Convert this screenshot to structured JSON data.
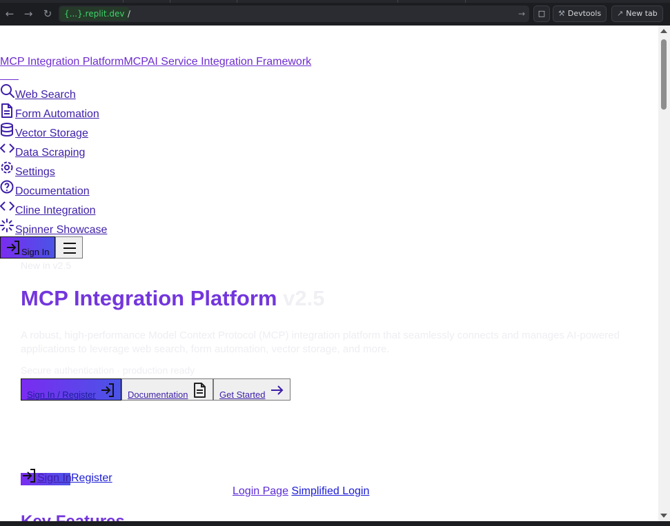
{
  "browser": {
    "url_host": "{...}.replit.dev",
    "url_path": "/",
    "devtools_label": "Devtools",
    "newtab_label": "New tab"
  },
  "header": {
    "brand_name": "MCP Integration Platform",
    "brand_short": "MCP",
    "brand_tagline": "AI Service Integration Framework"
  },
  "nav": {
    "items": [
      {
        "label": "Web Search",
        "icon": "search-icon"
      },
      {
        "label": "Form Automation",
        "icon": "file-text-icon"
      },
      {
        "label": "Vector Storage",
        "icon": "database-icon"
      },
      {
        "label": "Data Scraping",
        "icon": "code-icon"
      },
      {
        "label": "Settings",
        "icon": "gear-icon"
      },
      {
        "label": "Documentation",
        "icon": "help-circle-icon"
      },
      {
        "label": "Cline Integration",
        "icon": "code-icon"
      },
      {
        "label": "Spinner Showcase",
        "icon": "loader-icon"
      }
    ],
    "sign_in_label": "Sign In"
  },
  "hero": {
    "badge": "New in v2.5",
    "title": "MCP Integration Platform",
    "version": "v2.5",
    "description": "A robust, high-performance Model Context Protocol (MCP) integration platform that seamlessly connects and manages AI-powered applications to leverage web search, form automation, vector storage, and more.",
    "sub": "Secure authentication · production ready",
    "cta_signin": "Sign In / Register",
    "cta_docs": "Documentation",
    "cta_start": "Get Started"
  },
  "auth": {
    "sign_in": "Sign In",
    "register": "Register",
    "login_page": "Login Page",
    "simplified_login": "Simplified Login"
  },
  "features": {
    "heading": "Key Features"
  },
  "colors": {
    "accent": "#7336dc",
    "gradient_start": "#7a2cf0",
    "gradient_end": "#4a54e6",
    "link": "#1a1ad6"
  }
}
